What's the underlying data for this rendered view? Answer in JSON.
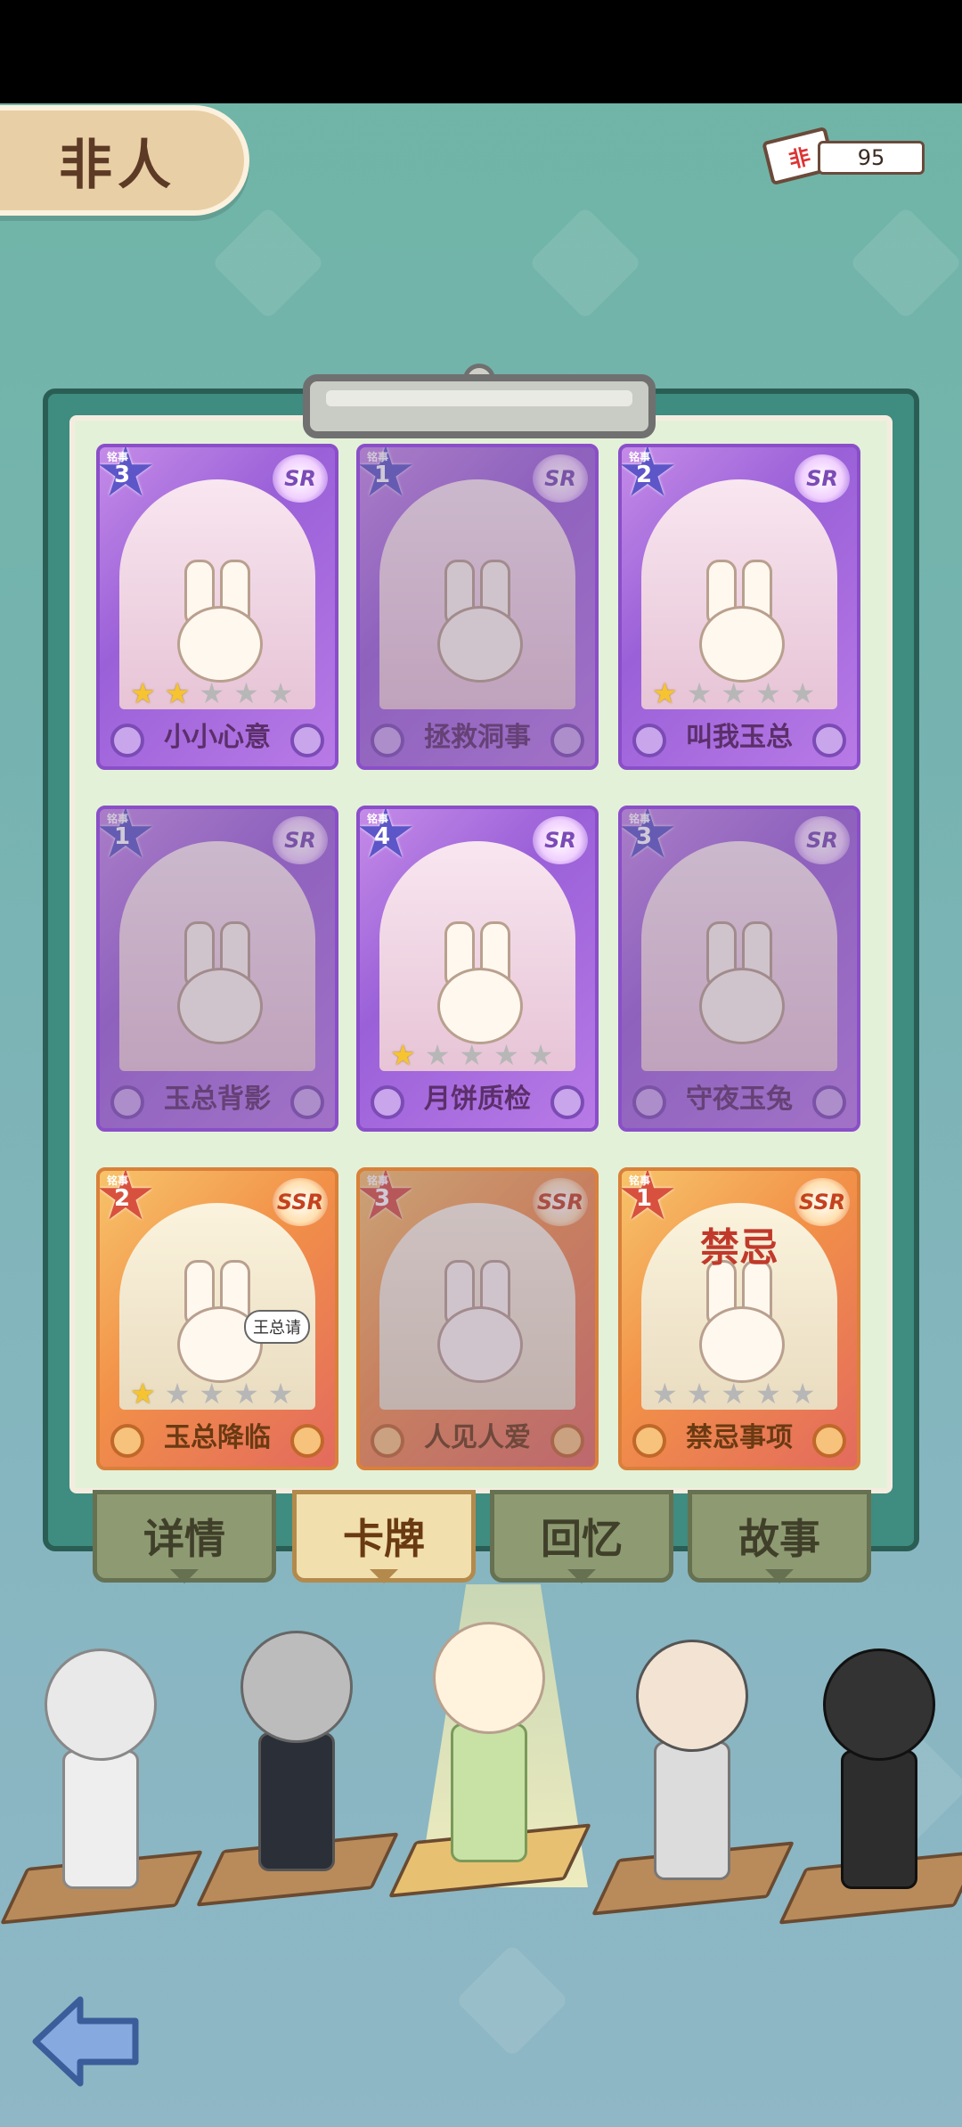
{
  "screen_title": "非人",
  "currency": {
    "icon_glyph": "非",
    "amount": "95"
  },
  "cards": [
    {
      "name": "小小心意",
      "rarity": "SR",
      "badge_tag": "铭事",
      "badge_num": "3",
      "stars_on": 2,
      "stars_total": 5,
      "dim": false
    },
    {
      "name": "拯救洞事",
      "rarity": "SR",
      "badge_tag": "铭事",
      "badge_num": "1",
      "stars_on": 0,
      "stars_total": 0,
      "dim": true
    },
    {
      "name": "叫我玉总",
      "rarity": "SR",
      "badge_tag": "铭事",
      "badge_num": "2",
      "stars_on": 1,
      "stars_total": 5,
      "dim": false
    },
    {
      "name": "玉总背影",
      "rarity": "SR",
      "badge_tag": "铭事",
      "badge_num": "1",
      "stars_on": 0,
      "stars_total": 0,
      "dim": true
    },
    {
      "name": "月饼质检",
      "rarity": "SR",
      "badge_tag": "铭事",
      "badge_num": "4",
      "stars_on": 1,
      "stars_total": 5,
      "dim": false
    },
    {
      "name": "守夜玉兔",
      "rarity": "SR",
      "badge_tag": "铭事",
      "badge_num": "3",
      "stars_on": 0,
      "stars_total": 0,
      "dim": true
    },
    {
      "name": "玉总降临",
      "rarity": "SSR",
      "badge_tag": "铭事",
      "badge_num": "2",
      "stars_on": 1,
      "stars_total": 5,
      "dim": false
    },
    {
      "name": "人见人爱",
      "rarity": "SSR",
      "badge_tag": "铭事",
      "badge_num": "3",
      "stars_on": 0,
      "stars_total": 0,
      "dim": true
    },
    {
      "name": "禁忌事项",
      "rarity": "SSR",
      "badge_tag": "铭事",
      "badge_num": "1",
      "stars_on": 0,
      "stars_total": 5,
      "dim": false
    }
  ],
  "art_overlay_text": {
    "card8_title": "禁忌",
    "card7_bubble": "王总请"
  },
  "tabs": [
    "详情",
    "卡牌",
    "回忆",
    "故事"
  ],
  "active_tab": "卡牌",
  "characters": [
    "white-fox-girl",
    "deer-man",
    "bunny-girl",
    "tea-man",
    "shadow-man"
  ],
  "colors": {
    "sr_purple": "#9a60d8",
    "ssr_orange": "#f29048",
    "board_green": "#3f8c80",
    "star_gold": "#f6c431"
  }
}
